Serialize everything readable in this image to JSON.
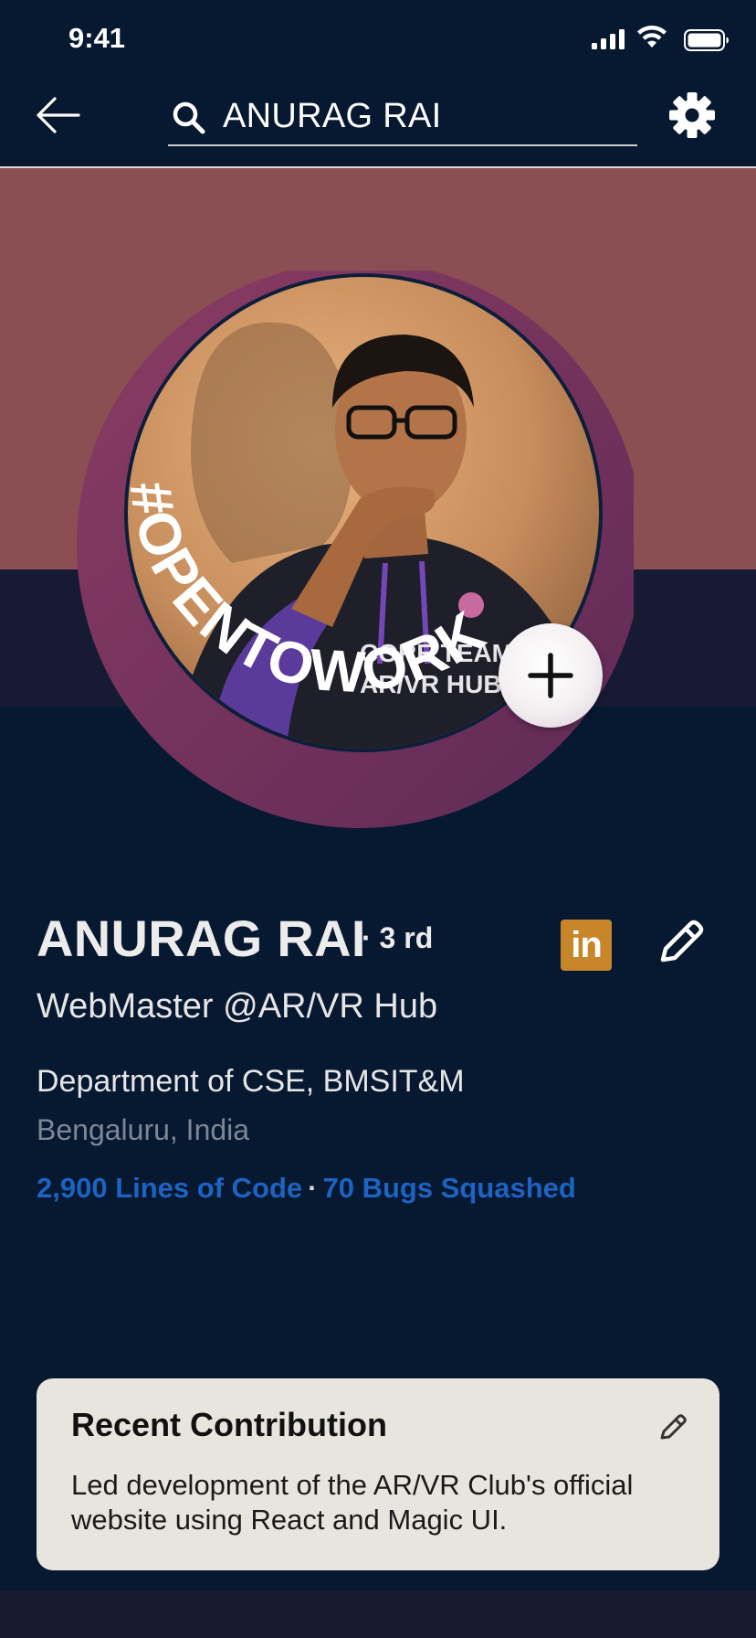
{
  "status_bar": {
    "time": "9:41"
  },
  "header": {
    "search_value": "ANURAG RAI"
  },
  "profile": {
    "badge_text": "#OPENTOWORK",
    "name": "ANURAG RAI",
    "connection_degree": "· 3 rd",
    "linkedin_label": "in",
    "headline": "WebMaster @AR/VR Hub",
    "department": "Department of CSE, BMSIT&M",
    "location": "Bengaluru, India",
    "stats": {
      "lines_of_code": "2,900 Lines of Code",
      "separator": "·",
      "bugs_squashed": "70 Bugs Squashed"
    },
    "photo": {
      "shirt_line1": "CORE TEAM",
      "shirt_line2": "AR/VR HUB"
    }
  },
  "recent_contribution": {
    "title": "Recent Contribution",
    "body": "Led development of the AR/VR Club's official website using React and Magic UI."
  },
  "colors": {
    "background": "#071831",
    "cover": "#8b4f53",
    "open_to_work_ring": "#7a3a66",
    "stats_link": "#1d63c2",
    "linkedin_badge": "#c8862a",
    "card_background": "#e8e5df"
  },
  "icons": [
    "back-arrow-icon",
    "search-icon",
    "gear-icon",
    "plus-icon",
    "linkedin-icon",
    "pencil-icon",
    "signal-icon",
    "wifi-icon",
    "battery-icon"
  ]
}
